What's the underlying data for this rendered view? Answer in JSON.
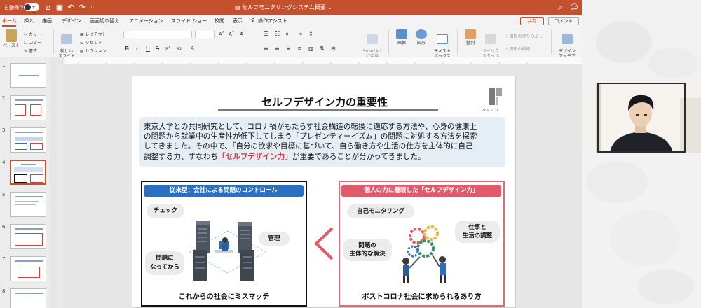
{
  "titlebar": {
    "autosave_label": "自動保存",
    "autosave_state": "オフ",
    "document_title": "セルフモニタリングシステム概要",
    "title_chevron": "⌄"
  },
  "ribbon_tabs": [
    "ホーム",
    "挿入",
    "描画",
    "デザイン",
    "画面切り替え",
    "アニメーション",
    "スライド ショー",
    "校閲",
    "表示"
  ],
  "tell_me": "操作アシスト",
  "share_label": "共有",
  "comment_label": "コメント",
  "ribbon": {
    "paste": "ペースト",
    "cut": "カット",
    "copy": "コピー",
    "format": "書式",
    "new_slide": "新しい\nスライド",
    "layout": "レイアウト",
    "reset": "リセット",
    "section": "セクション",
    "smartart": "SmartArt\nに変換",
    "image": "画像",
    "shapes": "図形",
    "textbox": "テキスト\nボックス",
    "arrange": "整列",
    "quick_styles": "クイック\nスタイル",
    "shape_fill": "図形の塗りつぶし",
    "shape_outline": "図形の枠線",
    "design_ideas": "デザイン\nアイデア"
  },
  "thumbnails": [
    "1",
    "2",
    "3",
    "4",
    "5",
    "6",
    "7",
    "8"
  ],
  "selected_slide": "4",
  "slide": {
    "title": "セルフデザイン力の重要性",
    "logo_text": "PERSOL",
    "intro_line1": "東京大学との共同研究として、コロナ禍がもたらす社会構造の転換に適応する方法や、心身の健康上",
    "intro_line2": "の問題から就業中の生産性が低下してしまう「プレゼンティーイズム」の問題に対処する方法を探索",
    "intro_line3": "してきました。その中で、「自分の欲求や目標に基づいて、自ら働き方や生活の仕方を主体的に自己",
    "intro_line4_a": "調整する力、すなわち",
    "intro_line4_hl": "「セルフデザイン力」",
    "intro_line4_b": "が重要であることが分かってきました。",
    "left_panel": {
      "heading": "従来型：会社による問題のコントロール",
      "bubbles": [
        "チェック",
        "管理",
        "問題に\nなってから"
      ],
      "caption": "これからの社会にミスマッチ"
    },
    "right_panel": {
      "heading": "個人の力に着眼した「セルフデザイン力」",
      "bubbles": [
        "自己モニタリング",
        "仕事と\n生活の調整",
        "問題の\n主体的な解決"
      ],
      "caption": "ポストコロナ社会に求められるあり方"
    }
  },
  "colors": {
    "titlebar": "#c5502e",
    "left_heading": "#2a6fc0",
    "right_heading": "#e2596a",
    "highlight": "#d6394a",
    "intro_bg": "#e6eef5"
  }
}
